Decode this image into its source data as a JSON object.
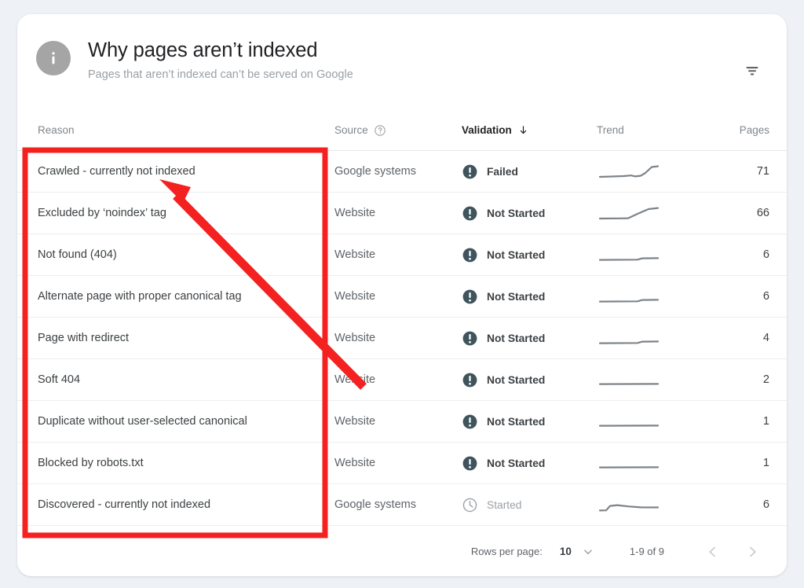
{
  "header": {
    "icon": "info-icon",
    "title": "Why pages aren’t indexed",
    "subtitle": "Pages that aren’t indexed can’t be served on Google",
    "filter_icon": "filter-icon"
  },
  "table": {
    "columns": {
      "reason": "Reason",
      "source": "Source",
      "source_help_icon": "help-circle-icon",
      "validation": "Validation",
      "validation_sort_icon": "arrow-down-icon",
      "trend": "Trend",
      "pages": "Pages"
    },
    "rows": [
      {
        "reason": "Crawled - currently not indexed",
        "source": "Google systems",
        "validation": "Failed",
        "validation_state": "failed",
        "validation_icon": "exclamation-circle-icon",
        "trend": "rising-late",
        "pages": "71"
      },
      {
        "reason": "Excluded by ‘noindex’ tag",
        "source": "Website",
        "validation": "Not Started",
        "validation_state": "not-started",
        "validation_icon": "exclamation-circle-icon",
        "trend": "rising-ramp",
        "pages": "66"
      },
      {
        "reason": "Not found (404)",
        "source": "Website",
        "validation": "Not Started",
        "validation_state": "not-started",
        "validation_icon": "exclamation-circle-icon",
        "trend": "flat-step",
        "pages": "6"
      },
      {
        "reason": "Alternate page with proper canonical tag",
        "source": "Website",
        "validation": "Not Started",
        "validation_state": "not-started",
        "validation_icon": "exclamation-circle-icon",
        "trend": "flat-step",
        "pages": "6"
      },
      {
        "reason": "Page with redirect",
        "source": "Website",
        "validation": "Not Started",
        "validation_state": "not-started",
        "validation_icon": "exclamation-circle-icon",
        "trend": "flat-step",
        "pages": "4"
      },
      {
        "reason": "Soft 404",
        "source": "Website",
        "validation": "Not Started",
        "validation_state": "not-started",
        "validation_icon": "exclamation-circle-icon",
        "trend": "flat",
        "pages": "2"
      },
      {
        "reason": "Duplicate without user-selected canonical",
        "source": "Website",
        "validation": "Not Started",
        "validation_state": "not-started",
        "validation_icon": "exclamation-circle-icon",
        "trend": "flat",
        "pages": "1"
      },
      {
        "reason": "Blocked by robots.txt",
        "source": "Website",
        "validation": "Not Started",
        "validation_state": "not-started",
        "validation_icon": "exclamation-circle-icon",
        "trend": "flat",
        "pages": "1"
      },
      {
        "reason": "Discovered - currently not indexed",
        "source": "Google systems",
        "validation": "Started",
        "validation_state": "started",
        "validation_icon": "clock-icon",
        "trend": "bump-early",
        "pages": "6"
      }
    ]
  },
  "footer": {
    "rows_per_page_label": "Rows per page:",
    "rows_per_page_value": "10",
    "rows_per_page_caret_icon": "chevron-down-icon",
    "range_label": "1-9 of 9",
    "prev_icon": "chevron-left-icon",
    "next_icon": "chevron-right-icon"
  },
  "annotation": {
    "color": "#f42121",
    "highlight_box": "red-rectangle-around-reason-column",
    "arrow": "red-arrow-pointing-to-first-reason"
  },
  "colors": {
    "page_background": "#eef1f6",
    "card_background": "#ffffff",
    "status_dark": "#3f545c",
    "muted_text": "#9aa0a6",
    "annotation_red": "#f42121"
  }
}
